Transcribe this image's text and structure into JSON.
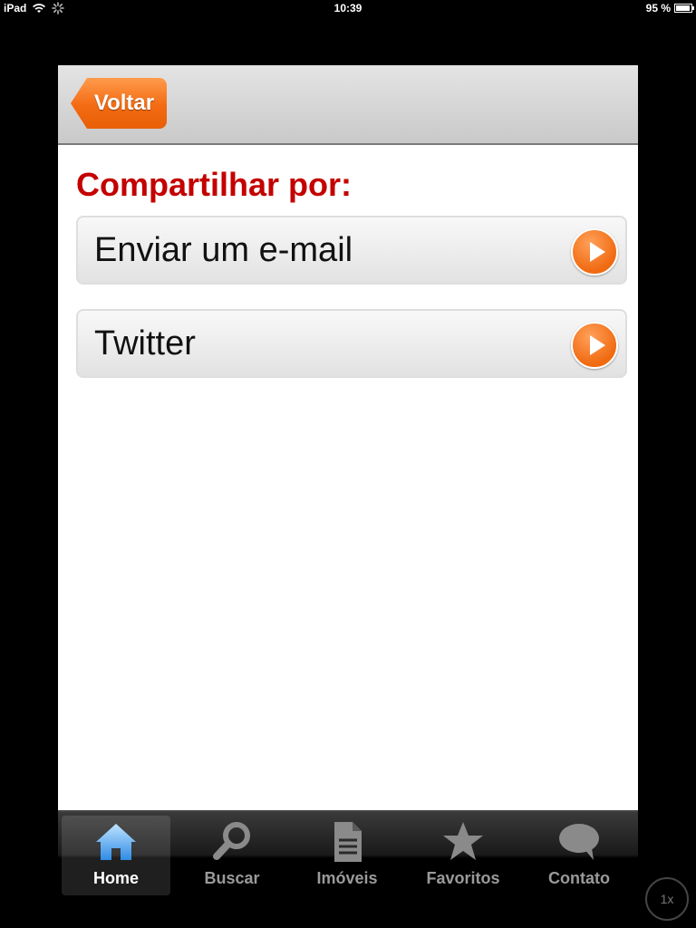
{
  "status_bar": {
    "device": "iPad",
    "time": "10:39",
    "battery": "95 %"
  },
  "nav": {
    "back_label": "Voltar"
  },
  "share": {
    "title": "Compartilhar por:",
    "items": [
      {
        "label": "Enviar um e-mail"
      },
      {
        "label": "Twitter"
      }
    ]
  },
  "tabs": [
    {
      "label": "Home",
      "icon": "home-icon",
      "active": true
    },
    {
      "label": "Buscar",
      "icon": "search-icon",
      "active": false
    },
    {
      "label": "Imóveis",
      "icon": "document-icon",
      "active": false
    },
    {
      "label": "Favoritos",
      "icon": "star-icon",
      "active": false
    },
    {
      "label": "Contato",
      "icon": "chat-bubble-icon",
      "active": false
    }
  ],
  "zoom": "1x",
  "colors": {
    "accent_orange": "#f36b12",
    "title_red": "#c40000",
    "active_tab_icon": "#5ab0ff"
  }
}
